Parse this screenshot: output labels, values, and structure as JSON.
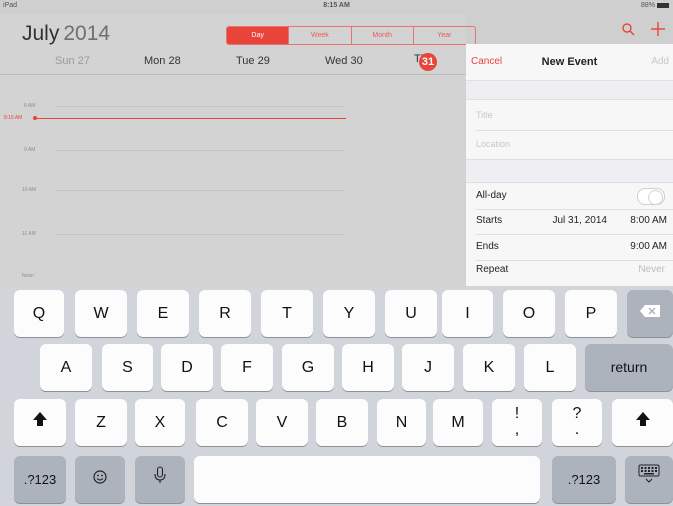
{
  "statusbar": {
    "device": "iPad",
    "time": "8:15 AM",
    "battery": "88%"
  },
  "calendar": {
    "month": "July",
    "year": "2014",
    "view_tabs": [
      "Day",
      "Week",
      "Month",
      "Year"
    ],
    "days": [
      "Sun 27",
      "Mon 28",
      "Tue 29",
      "Wed 30",
      "Thu"
    ],
    "today_number": "31",
    "hours": [
      "8 AM",
      "9 AM",
      "10 AM",
      "11 AM",
      "Noon"
    ],
    "now_label": "8:15 AM"
  },
  "top_icons": {
    "search": "search-icon",
    "add": "plus-icon"
  },
  "new_event": {
    "cancel": "Cancel",
    "title": "New Event",
    "add": "Add",
    "title_placeholder": "Title",
    "location_placeholder": "Location",
    "allday_label": "All-day",
    "starts_label": "Starts",
    "starts_date": "Jul 31, 2014",
    "starts_time": "8:00 AM",
    "ends_label": "Ends",
    "ends_time": "9:00 AM",
    "repeat_label": "Repeat",
    "repeat_value": "Never",
    "accent_color": "#e8443a"
  },
  "keyboard": {
    "row1": [
      "Q",
      "W",
      "E",
      "R",
      "T",
      "Y",
      "U",
      "I",
      "O",
      "P"
    ],
    "row2": [
      "A",
      "S",
      "D",
      "F",
      "G",
      "H",
      "J",
      "K",
      "L"
    ],
    "row3": [
      "Z",
      "X",
      "C",
      "V",
      "B",
      "N",
      "M"
    ],
    "punct1_top": "!",
    "punct1_bottom": ",",
    "punct2_top": "?",
    "punct2_bottom": ".",
    "return": "return",
    "numbers_left": ".?123",
    "numbers_right": ".?123",
    "icons": [
      "delete-icon",
      "shift-icon",
      "emoji-icon",
      "microphone-icon",
      "keyboard-hide-icon"
    ]
  }
}
